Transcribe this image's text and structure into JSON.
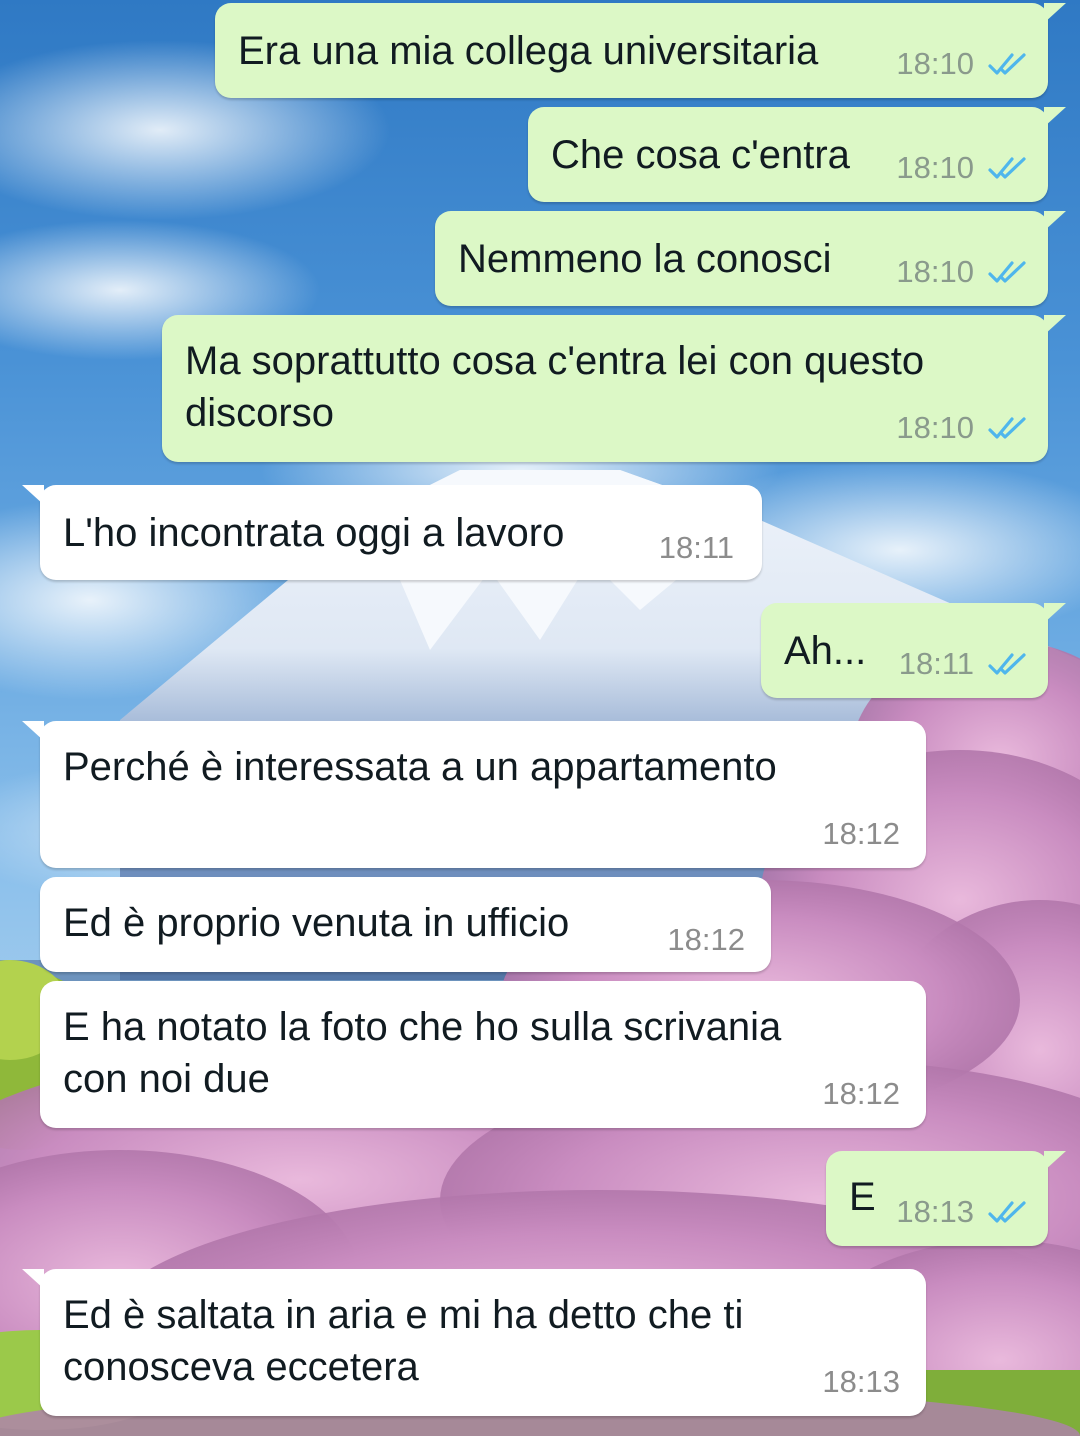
{
  "conversation": {
    "messages": [
      {
        "direction": "outgoing",
        "text": "Era una mia collega universitaria",
        "time": "18:10",
        "read_status": "read"
      },
      {
        "direction": "outgoing",
        "text": "Che cosa c'entra",
        "time": "18:10",
        "read_status": "read"
      },
      {
        "direction": "outgoing",
        "text": "Nemmeno la conosci",
        "time": "18:10",
        "read_status": "read"
      },
      {
        "direction": "outgoing",
        "text": "Ma soprattutto cosa c'entra lei con questo\ndiscorso",
        "time": "18:10",
        "read_status": "read"
      },
      {
        "direction": "incoming",
        "text": "L'ho incontrata oggi a lavoro",
        "time": "18:11"
      },
      {
        "direction": "outgoing",
        "text": "Ah...",
        "time": "18:11",
        "read_status": "read"
      },
      {
        "direction": "incoming",
        "text": "Perché è interessata a un appartamento",
        "time": "18:12"
      },
      {
        "direction": "incoming",
        "text": "Ed è proprio venuta in ufficio",
        "time": "18:12"
      },
      {
        "direction": "incoming",
        "text": "E ha notato la foto che ho sulla scrivania\ncon noi due",
        "time": "18:12"
      },
      {
        "direction": "outgoing",
        "text": "E",
        "time": "18:13",
        "read_status": "read"
      },
      {
        "direction": "incoming",
        "text": "Ed è saltata in aria e mi ha detto che ti\nconosceva eccetera",
        "time": "18:13"
      }
    ]
  },
  "icons": {
    "read_receipt": "double-check-icon"
  },
  "colors": {
    "outgoing_bubble": "#dcf8c6",
    "incoming_bubble": "#ffffff",
    "read_tick": "#4fb6ec",
    "timestamp": "#8a9a8c"
  },
  "wallpaper": {
    "description_icon": "mount-fuji-cherry-blossom-wallpaper"
  }
}
